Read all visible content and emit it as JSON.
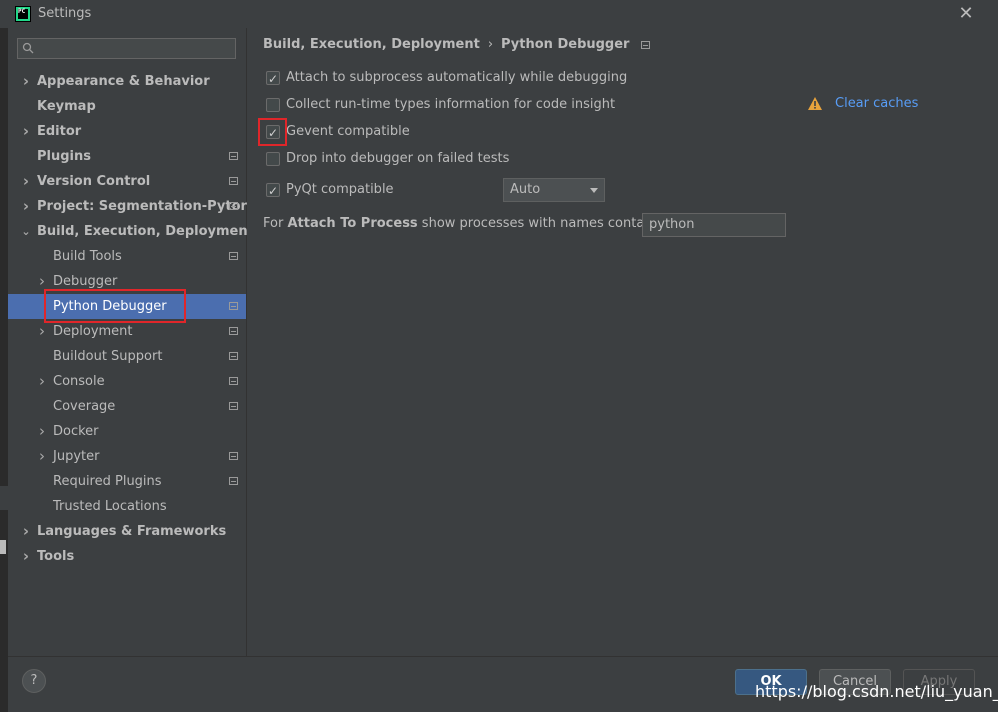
{
  "window": {
    "title": "Settings",
    "app_icon": "pycharm-icon",
    "app_icon_text": "PC"
  },
  "sidebar": {
    "search_placeholder": "",
    "items": [
      {
        "label": "Appearance & Behavior",
        "bold": true,
        "expand": "collapsed",
        "level": 0,
        "project_icon": false
      },
      {
        "label": "Keymap",
        "bold": true,
        "expand": "none",
        "level": 0,
        "project_icon": false
      },
      {
        "label": "Editor",
        "bold": true,
        "expand": "collapsed",
        "level": 0,
        "project_icon": false
      },
      {
        "label": "Plugins",
        "bold": true,
        "expand": "none",
        "level": 0,
        "project_icon": true
      },
      {
        "label": "Version Control",
        "bold": true,
        "expand": "collapsed",
        "level": 0,
        "project_icon": true
      },
      {
        "label": "Project: Segmentation-Pytorch",
        "bold": true,
        "expand": "collapsed",
        "level": 0,
        "project_icon": true
      },
      {
        "label": "Build, Execution, Deployment",
        "bold": true,
        "expand": "expanded",
        "level": 0,
        "project_icon": false
      },
      {
        "label": "Build Tools",
        "bold": false,
        "expand": "none",
        "level": 1,
        "project_icon": true
      },
      {
        "label": "Debugger",
        "bold": false,
        "expand": "collapsed",
        "level": 1,
        "project_icon": false
      },
      {
        "label": "Python Debugger",
        "bold": false,
        "expand": "none",
        "level": 1,
        "project_icon": true,
        "selected": true
      },
      {
        "label": "Deployment",
        "bold": false,
        "expand": "collapsed",
        "level": 1,
        "project_icon": true
      },
      {
        "label": "Buildout Support",
        "bold": false,
        "expand": "none",
        "level": 1,
        "project_icon": true
      },
      {
        "label": "Console",
        "bold": false,
        "expand": "collapsed",
        "level": 1,
        "project_icon": true
      },
      {
        "label": "Coverage",
        "bold": false,
        "expand": "none",
        "level": 1,
        "project_icon": true
      },
      {
        "label": "Docker",
        "bold": false,
        "expand": "collapsed",
        "level": 1,
        "project_icon": false
      },
      {
        "label": "Jupyter",
        "bold": false,
        "expand": "collapsed",
        "level": 1,
        "project_icon": true
      },
      {
        "label": "Required Plugins",
        "bold": false,
        "expand": "none",
        "level": 1,
        "project_icon": true
      },
      {
        "label": "Trusted Locations",
        "bold": false,
        "expand": "none",
        "level": 1,
        "project_icon": false
      },
      {
        "label": "Languages & Frameworks",
        "bold": true,
        "expand": "collapsed",
        "level": 0,
        "project_icon": false
      },
      {
        "label": "Tools",
        "bold": true,
        "expand": "collapsed",
        "level": 0,
        "project_icon": false
      }
    ]
  },
  "content": {
    "breadcrumb": {
      "parent": "Build, Execution, Deployment",
      "separator": "›",
      "current": "Python Debugger"
    },
    "options": [
      {
        "label": "Attach to subprocess automatically while debugging",
        "checked": true
      },
      {
        "label": "Collect run-time types information for code insight",
        "checked": false
      },
      {
        "label": "Gevent compatible",
        "checked": true
      },
      {
        "label": "Drop into debugger on failed tests",
        "checked": false
      },
      {
        "label": "PyQt compatible",
        "checked": true
      }
    ],
    "clear_caches": "Clear caches",
    "pyqt_select_value": "Auto",
    "attach": {
      "prefix": "For ",
      "bold": "Attach To Process",
      "suffix": " show processes with names containing:",
      "value": "python"
    }
  },
  "footer": {
    "help": "?",
    "ok": "OK",
    "cancel": "Cancel",
    "apply": "Apply"
  },
  "watermark": "https://blog.csdn.net/liu_yuan_kai",
  "colors": {
    "selection": "#4b6eaf",
    "highlight": "#e0262a",
    "link": "#589df6",
    "warning": "#e8a33c"
  }
}
